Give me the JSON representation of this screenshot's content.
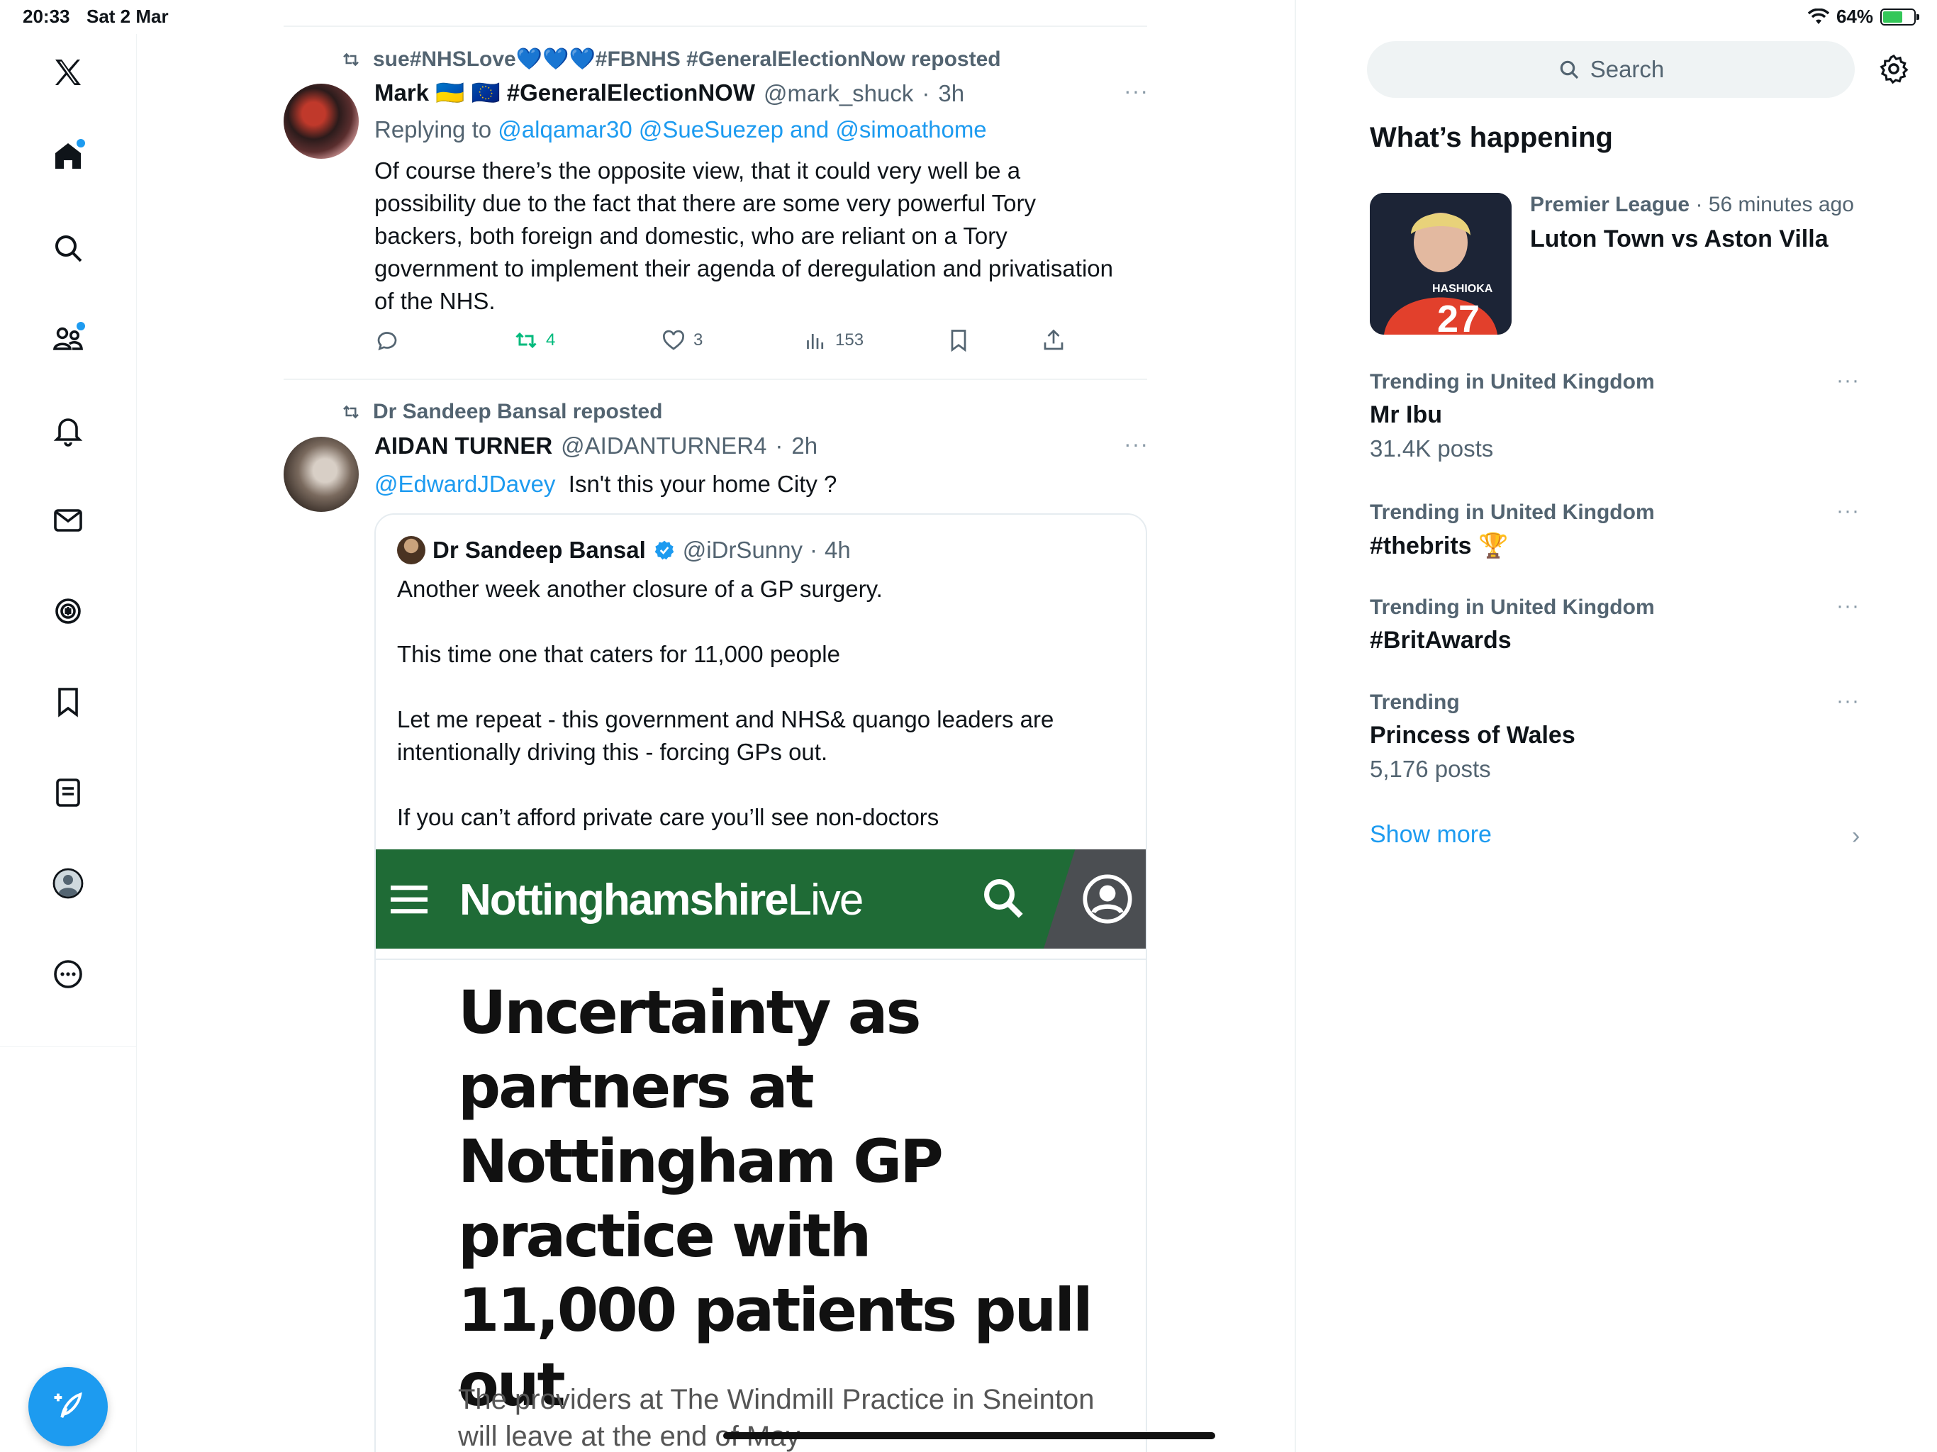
{
  "status": {
    "time": "20:33",
    "date": "Sat 2 Mar",
    "battery": "64%"
  },
  "nav": {
    "items": [
      "x-logo",
      "home",
      "explore",
      "communities",
      "notifications",
      "messages",
      "spaces",
      "bookmarks",
      "lists",
      "profile",
      "more"
    ]
  },
  "tweet1": {
    "repost_by": "sue#NHSLove💙💙💙#FBNHS #GeneralElectionNow reposted",
    "name": "Mark 🇺🇦 🇪🇺 #GeneralElectionNOW",
    "handle": "@mark_shuck",
    "time": "3h",
    "replying_prefix": "Replying to",
    "replying_to": "@alqamar30 @SueSuezep and @simoathome",
    "text": "Of course there’s the opposite view, that it could very well be a possibility due to the fact that there are some very powerful Tory backers, both foreign and domestic, who are reliant on a Tory government to implement their agenda of deregulation and privatisation of the NHS.",
    "retweets": "4",
    "likes": "3",
    "views": "153",
    "more": "···"
  },
  "tweet2": {
    "repost_by": "Dr Sandeep Bansal reposted",
    "name": "AIDAN TURNER",
    "handle": "@AIDANTURNER4",
    "time": "2h",
    "mention": "@EdwardJDavey",
    "text": "Isn't this your home City ?",
    "more": "···",
    "quote": {
      "name": "Dr Sandeep Bansal",
      "handle": "@iDrSunny",
      "time": "4h",
      "paragraphs": [
        "Another week another closure of a GP surgery.",
        "This time one that caters for 11,000 people",
        "Let me repeat - this government and NHS& quango leaders are intentionally driving this - forcing GPs out.",
        "If you can’t afford private care you’ll see non-doctors"
      ],
      "article": {
        "site_bold": "Nottinghamshire",
        "site_light": "Live",
        "headline": "Uncertainty as partners at Nottingham GP practice with 11,000 patients pull out",
        "standfirst": "The providers at The Windmill Practice in Sneinton will leave at the end of May"
      }
    }
  },
  "sidebar": {
    "search_placeholder": "Search",
    "title": "What’s happening",
    "featured": {
      "category": "Premier League",
      "time": "56 minutes ago",
      "title": "Luton Town vs Aston Villa",
      "image_text": "HASHIOKA"
    },
    "trends": [
      {
        "category": "Trending in United Kingdom",
        "name": "Mr Ibu",
        "posts": "31.4K posts"
      },
      {
        "category": "Trending in United Kingdom",
        "name": "#thebrits 🏆",
        "posts": ""
      },
      {
        "category": "Trending in United Kingdom",
        "name": "#BritAwards",
        "posts": ""
      },
      {
        "category": "Trending",
        "name": "Princess of Wales",
        "posts": "5,176 posts"
      }
    ],
    "show_more": "Show more"
  },
  "colors": {
    "accent": "#1d9bf0",
    "retweet_green": "#00ba7c",
    "nl_green": "#1f6b36"
  }
}
